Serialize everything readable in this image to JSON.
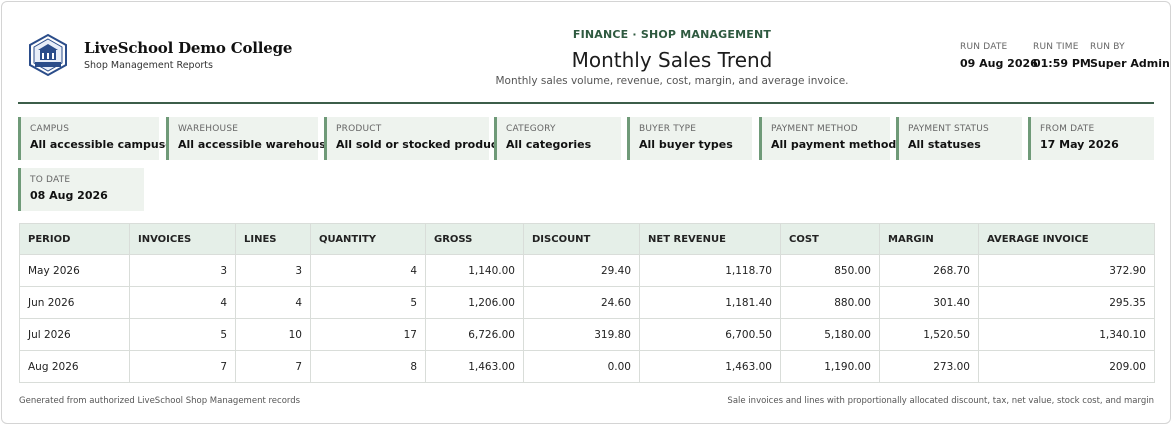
{
  "header": {
    "college_name": "LiveSchool Demo College",
    "college_subtitle": "Shop Management Reports",
    "kicker": "FINANCE · SHOP MANAGEMENT",
    "title": "Monthly Sales Trend",
    "subtitle": "Monthly sales volume, revenue, cost, margin, and average invoice.",
    "run": {
      "date_label": "RUN DATE",
      "date_value": "09 Aug 2026",
      "time_label": "RUN TIME",
      "time_value": "01:59 PM",
      "by_label": "RUN BY",
      "by_value": "Super Admin"
    }
  },
  "filters": [
    {
      "label": "CAMPUS",
      "value": "All accessible campuses"
    },
    {
      "label": "WAREHOUSE",
      "value": "All accessible warehouses"
    },
    {
      "label": "PRODUCT",
      "value": "All sold or stocked products"
    },
    {
      "label": "CATEGORY",
      "value": "All categories"
    },
    {
      "label": "BUYER TYPE",
      "value": "All buyer types"
    },
    {
      "label": "PAYMENT METHOD",
      "value": "All payment methods"
    },
    {
      "label": "PAYMENT STATUS",
      "value": "All statuses"
    },
    {
      "label": "FROM DATE",
      "value": "17 May 2026"
    },
    {
      "label": "TO DATE",
      "value": "08 Aug 2026"
    }
  ],
  "table": {
    "columns": [
      "PERIOD",
      "INVOICES",
      "LINES",
      "QUANTITY",
      "GROSS",
      "DISCOUNT",
      "NET REVENUE",
      "COST",
      "MARGIN",
      "AVERAGE INVOICE"
    ],
    "rows": [
      [
        "May 2026",
        "3",
        "3",
        "4",
        "1,140.00",
        "29.40",
        "1,118.70",
        "850.00",
        "268.70",
        "372.90"
      ],
      [
        "Jun 2026",
        "4",
        "4",
        "5",
        "1,206.00",
        "24.60",
        "1,181.40",
        "880.00",
        "301.40",
        "295.35"
      ],
      [
        "Jul 2026",
        "5",
        "10",
        "17",
        "6,726.00",
        "319.80",
        "6,700.50",
        "5,180.00",
        "1,520.50",
        "1,340.10"
      ],
      [
        "Aug 2026",
        "7",
        "7",
        "8",
        "1,463.00",
        "0.00",
        "1,463.00",
        "1,190.00",
        "273.00",
        "209.00"
      ]
    ]
  },
  "footer": {
    "left": "Generated from authorized LiveSchool Shop Management records",
    "right": "Sale invoices and lines with proportionally allocated discount, tax, net value, stock cost, and margin"
  },
  "colors": {
    "accent": "#2f5a40",
    "rule": "#3c5e4a",
    "filter_bg": "#eef3ee",
    "filter_border": "#6f9a78",
    "header_bg": "#e5efe8"
  },
  "icons": {
    "logo": "college-crest-icon"
  }
}
